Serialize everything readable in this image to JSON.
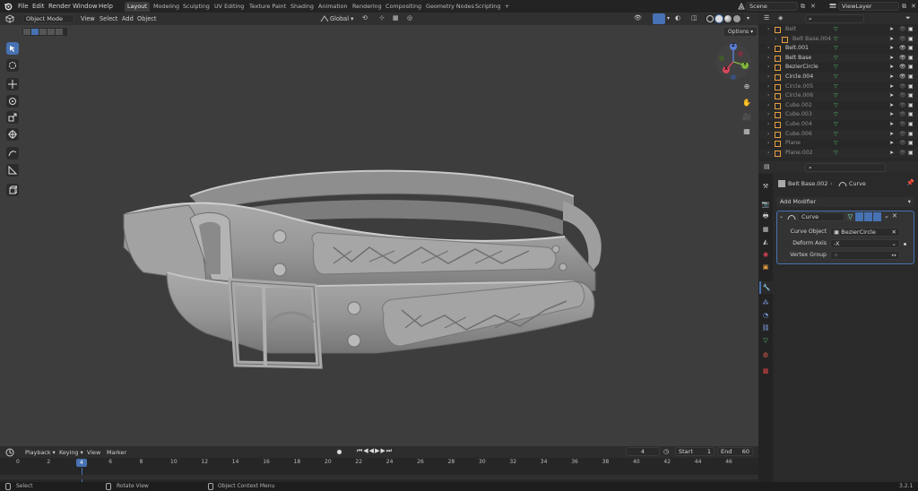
{
  "menu": [
    "File",
    "Edit",
    "Render",
    "Window",
    "Help"
  ],
  "workspaces": [
    "Layout",
    "Modeling",
    "Sculpting",
    "UV Editing",
    "Texture Paint",
    "Shading",
    "Animation",
    "Rendering",
    "Compositing",
    "Geometry Nodes",
    "Scripting"
  ],
  "active_workspace": "Layout",
  "add_workspace": "+",
  "scene": "Scene",
  "view_layer": "ViewLayer",
  "viewport": {
    "mode": "Object Mode",
    "menus": [
      "View",
      "Select",
      "Add",
      "Object"
    ],
    "orientation": "Global",
    "options": "Options",
    "gizmo_labels": {
      "z": "Z",
      "y": "Y",
      "x": "X"
    }
  },
  "outliner": {
    "items": [
      {
        "name": "Belt",
        "dim": true
      },
      {
        "name": "Belt Base.004",
        "dim": true
      },
      {
        "name": "Belt.001",
        "dim": false
      },
      {
        "name": "Belt Base",
        "dim": false
      },
      {
        "name": "BezierCircle",
        "dim": false
      },
      {
        "name": "Circle.004",
        "dim": false
      },
      {
        "name": "Circle.005",
        "dim": true
      },
      {
        "name": "Circle.006",
        "dim": true
      },
      {
        "name": "Cube.002",
        "dim": true
      },
      {
        "name": "Cube.003",
        "dim": true
      },
      {
        "name": "Cube.004",
        "dim": true
      },
      {
        "name": "Cube.006",
        "dim": true
      },
      {
        "name": "Plane",
        "dim": true
      },
      {
        "name": "Plane.002",
        "dim": true
      }
    ]
  },
  "properties": {
    "object": "Belt Base.002",
    "modifier_tab": "Curve",
    "add_modifier": "Add Modifier",
    "modifier_name": "Curve",
    "curve_object_label": "Curve Object",
    "curve_object_value": "BezierCircle",
    "deform_axis_label": "Deform Axis",
    "deform_axis_value": "-X",
    "vertex_group_label": "Vertex Group",
    "vertex_group_value": ""
  },
  "timeline": {
    "menus": [
      "Playback",
      "Keying",
      "View",
      "Marker"
    ],
    "current_frame": "4",
    "start_label": "Start",
    "start": "1",
    "end_label": "End",
    "end": "60",
    "ticks": [
      "0",
      "2",
      "4",
      "6",
      "8",
      "10",
      "12",
      "14",
      "16",
      "18",
      "20",
      "22",
      "24",
      "26",
      "28",
      "30",
      "32",
      "34",
      "36",
      "38",
      "40",
      "42",
      "44",
      "46"
    ],
    "playhead": 4
  },
  "status": {
    "select": "Select",
    "rotate": "Rotate View",
    "context": "Object Context Menu",
    "version": "3.2.1"
  }
}
